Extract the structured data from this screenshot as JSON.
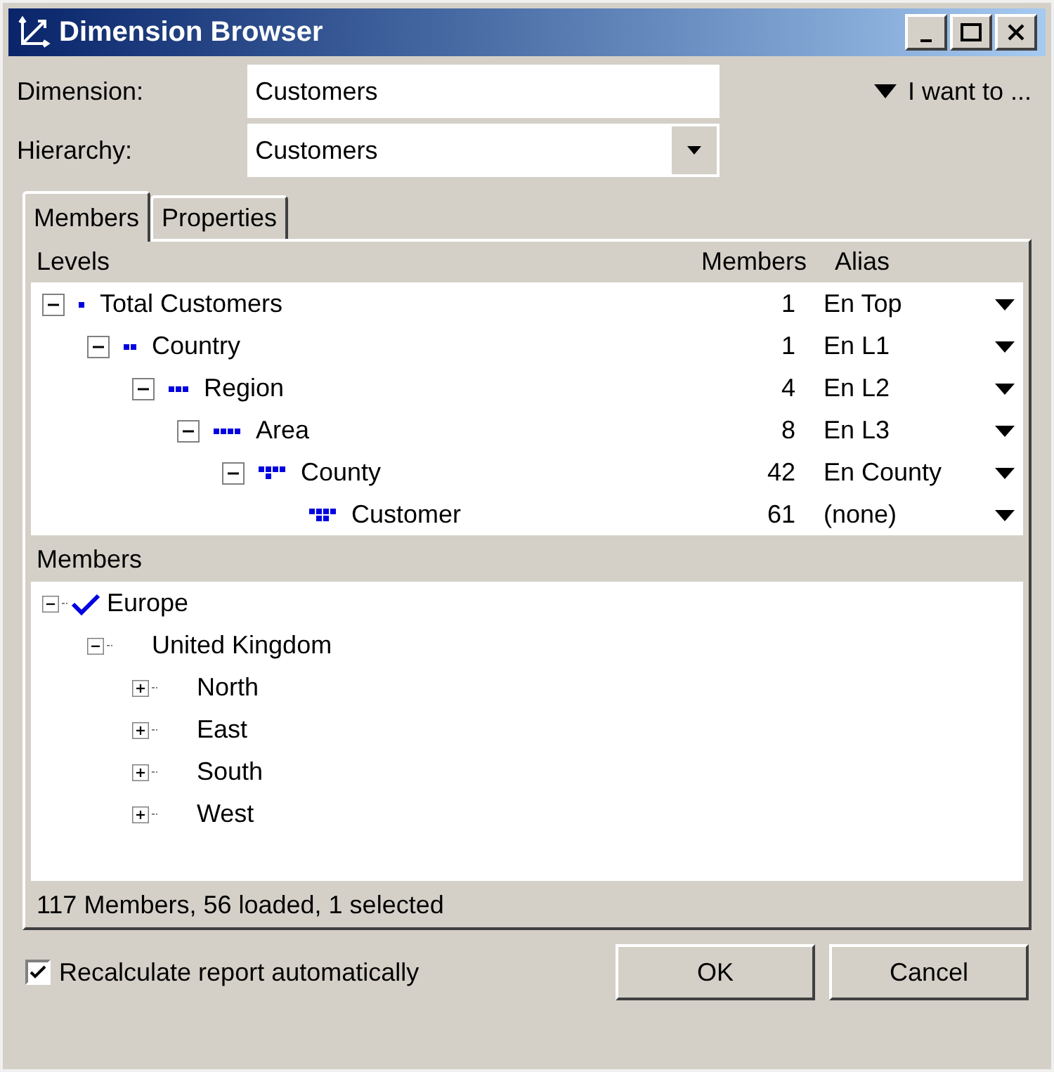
{
  "window": {
    "title": "Dimension Browser"
  },
  "dimension": {
    "label": "Dimension:",
    "value": "Customers"
  },
  "hierarchy": {
    "label": "Hierarchy:",
    "value": "Customers"
  },
  "menu": {
    "label": "I want to ..."
  },
  "tabs": [
    {
      "label": "Members",
      "selected": true
    },
    {
      "label": "Properties",
      "selected": false
    }
  ],
  "levels": {
    "title": "Levels",
    "columns": [
      "Members",
      "Alias"
    ],
    "items": [
      {
        "name": "Total Customers",
        "members": "1",
        "alias": "En Top",
        "expanded": true,
        "children": [
          {
            "name": "Country",
            "members": "1",
            "alias": "En L1",
            "expanded": true,
            "children": [
              {
                "name": "Region",
                "members": "4",
                "alias": "En L2",
                "expanded": true,
                "children": [
                  {
                    "name": "Area",
                    "members": "8",
                    "alias": "En L3",
                    "expanded": true,
                    "children": [
                      {
                        "name": "County",
                        "members": "42",
                        "alias": "En County",
                        "expanded": true,
                        "children": [
                          {
                            "name": "Customer",
                            "members": "61",
                            "alias": "(none)"
                          }
                        ]
                      }
                    ]
                  }
                ]
              }
            ]
          }
        ]
      }
    ]
  },
  "members": {
    "title": "Members",
    "items": [
      {
        "name": "Europe",
        "checked": true,
        "expanded": true,
        "children": [
          {
            "name": "United Kingdom",
            "checked": false,
            "expanded": true,
            "children": [
              {
                "name": "North",
                "checked": false,
                "expanded": false
              },
              {
                "name": "East",
                "checked": false,
                "expanded": false
              },
              {
                "name": "South",
                "checked": false,
                "expanded": false
              },
              {
                "name": "West",
                "checked": false,
                "expanded": false
              }
            ]
          }
        ]
      }
    ]
  },
  "status": "117 Members, 56 loaded, 1 selected",
  "recalculate": {
    "label": "Recalculate report automatically",
    "checked": true
  },
  "buttons": [
    "OK",
    "Cancel"
  ]
}
